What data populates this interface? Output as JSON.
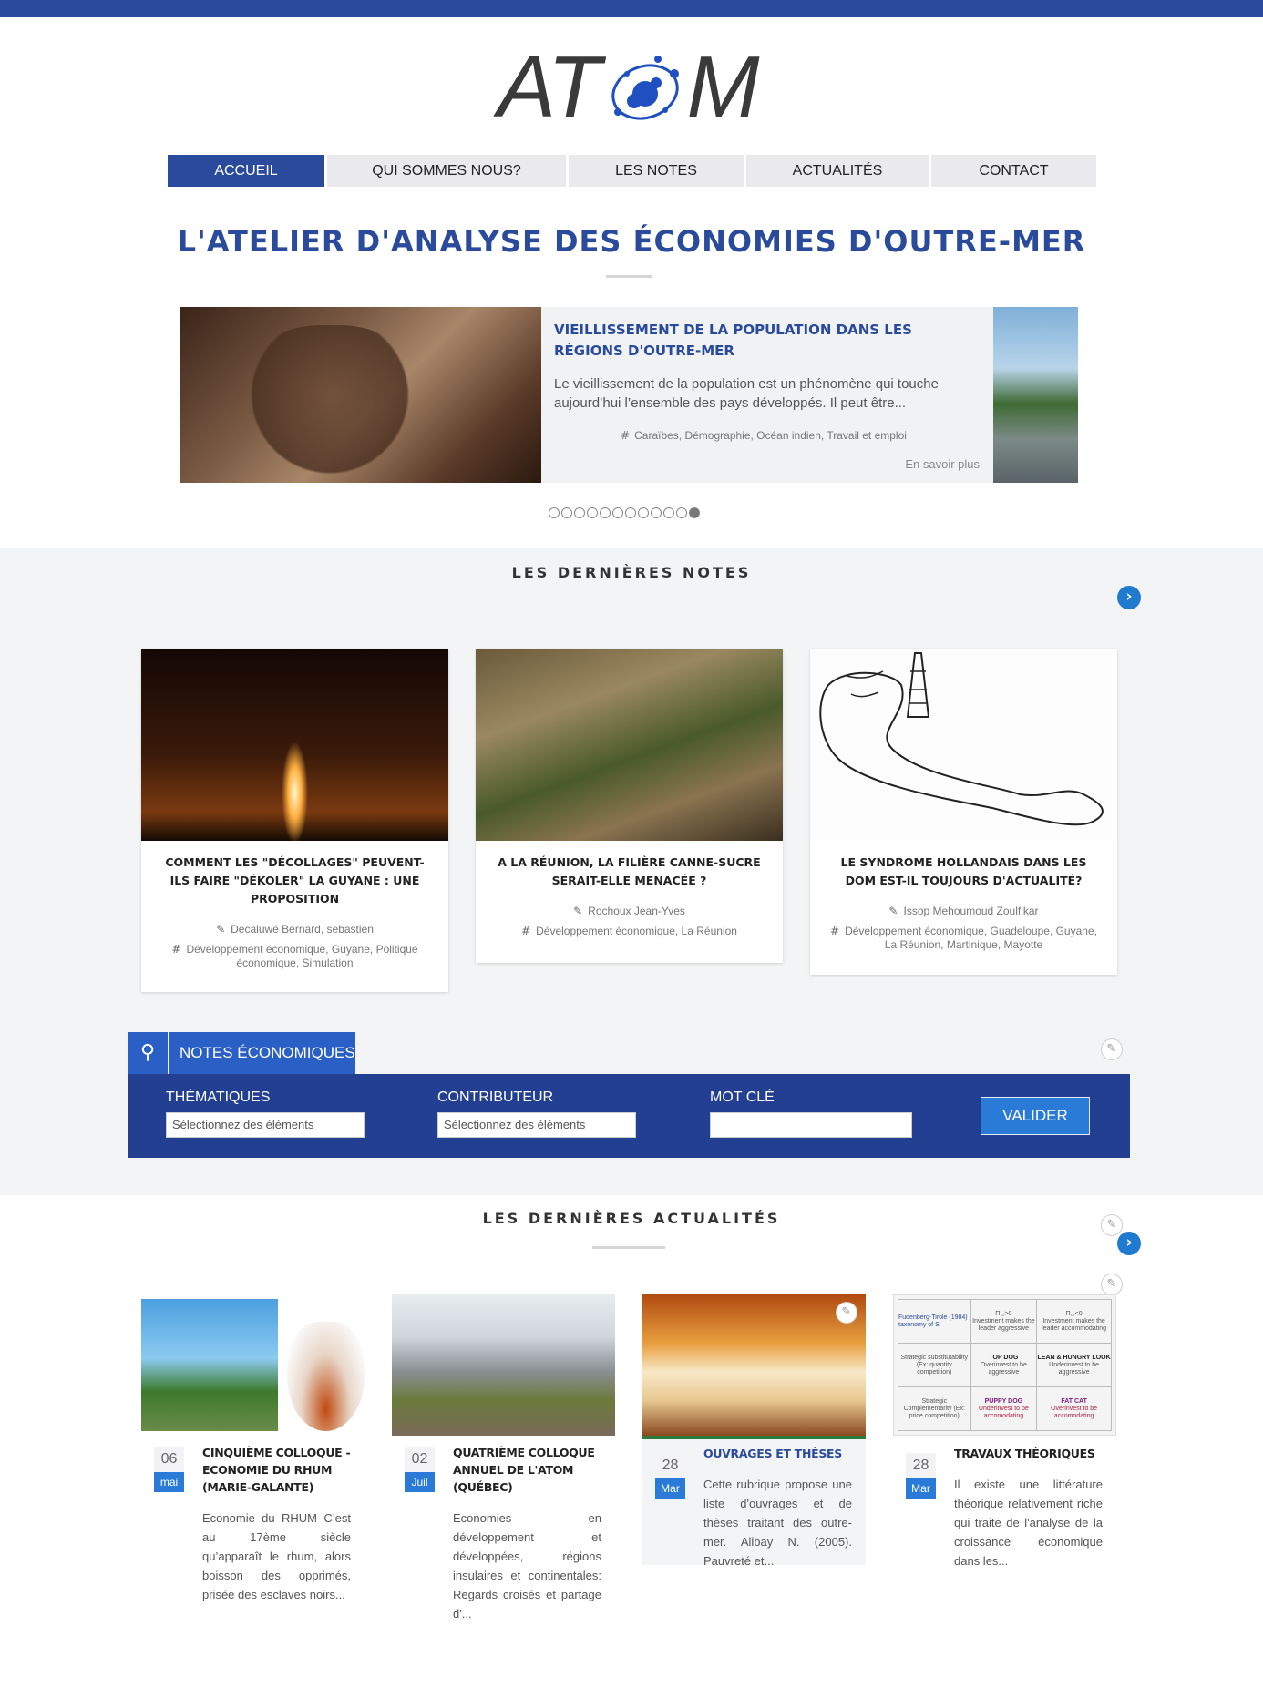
{
  "logo": {
    "text_a": "AT",
    "text_b": "M"
  },
  "nav": [
    {
      "label": "Accueil"
    },
    {
      "label": "Qui sommes nous?"
    },
    {
      "label": "Les notes"
    },
    {
      "label": "Actualités"
    },
    {
      "label": "Contact"
    }
  ],
  "tagline": "L'ATELIER D'ANALYSE DES ÉCONOMIES D'OUTRE-MER",
  "slider": {
    "title": "Vieillissement de la population dans les régions d'Outre-Mer",
    "text": "Le vieillissement de la population est un phénomène qui touche aujourd’hui l’ensemble des pays développés. Il peut être...",
    "tags": "Caraïbes, Démographie, Océan indien, Travail et emploi",
    "more": "En savoir plus",
    "dot_count": 12,
    "active_dot": 11
  },
  "notes": {
    "title": "LES DERNIÈRES NOTES",
    "cards": [
      {
        "title": "Comment les \"décollages\" peuvent-ils faire \"dékoler\" la Guyane : une proposition",
        "author": "Decaluwé Bernard, sebastien",
        "tags": "Développement économique, Guyane, Politique économique, Simulation"
      },
      {
        "title": "A la Réunion, la filière canne-sucre serait-elle menacée ?",
        "author": "Rochoux Jean-Yves",
        "tags": "Développement économique, La Réunion"
      },
      {
        "title": "Le syndrome hollandais dans les DOM est-il toujours d'actualité?",
        "author": "Issop Mehoumoud Zoulfikar",
        "tags": "Développement économique, Guadeloupe, Guyane, La Réunion, Martinique, Mayotte"
      }
    ]
  },
  "search": {
    "tab_label": "NOTES ÉCONOMIQUES",
    "thematiques_label": "THÉMATIQUES",
    "thematiques_placeholder": "Sélectionnez des éléments",
    "contributeur_label": "CONTRIBUTEUR",
    "contributeur_placeholder": "Sélectionnez des éléments",
    "motcle_label": "MOT CLÉ",
    "submit_label": "VALIDER"
  },
  "news": {
    "title": "LES DERNIÈRES ACTUALITÉS",
    "cards": [
      {
        "day": "06",
        "month": "mai",
        "title": "Cinquième colloque - Economie du rhum (Marie-Galante)",
        "text": "Economie du RHUM C’est au 17ème siècle qu’apparaît le rhum, alors boisson des opprimés, prisée des esclaves noirs..."
      },
      {
        "day": "02",
        "month": "Juil",
        "title": "Quatrième colloque annuel de l'ATOM (Québec)",
        "text": "Economies en développement et développées, régions insulaires et continentales: Regards croisés et partage d'..."
      },
      {
        "day": "28",
        "month": "Mar",
        "title": "Ouvrages et thèses",
        "text": "Cette rubrique propose une liste d'ouvrages et de thèses traitant des outre-mer. Alibay N. (2005). Pauvreté et..."
      },
      {
        "day": "28",
        "month": "Mar",
        "title": "Travaux théoriques",
        "text": "Il existe une littérature théorique relativement riche qui traite de l'analyse de la croissance économique dans les..."
      }
    ],
    "table_image": {
      "head": [
        "Fudenberg-Tirole (1984) taxonomy of SI",
        "Π₁₂>0",
        "Π₁₂<0"
      ],
      "head_sub": [
        "",
        "Investment makes the leader aggressive",
        "Investment makes the leader accommodating"
      ],
      "row1": [
        "Strategic substitutability (Ex: quantity competition)",
        "TOP DOG",
        "LEAN & HUNGRY LOOK"
      ],
      "row1_sub": [
        "",
        "Overinvest to be aggressive",
        "Underinvest to be aggressive"
      ],
      "row2": [
        "Strategic Complementarity (Ex: price competition)",
        "PUPPY DOG",
        "FAT CAT"
      ],
      "row2_sub": [
        "",
        "Underinvest to be accomodating",
        "Overinvest to be accomodating"
      ]
    }
  }
}
